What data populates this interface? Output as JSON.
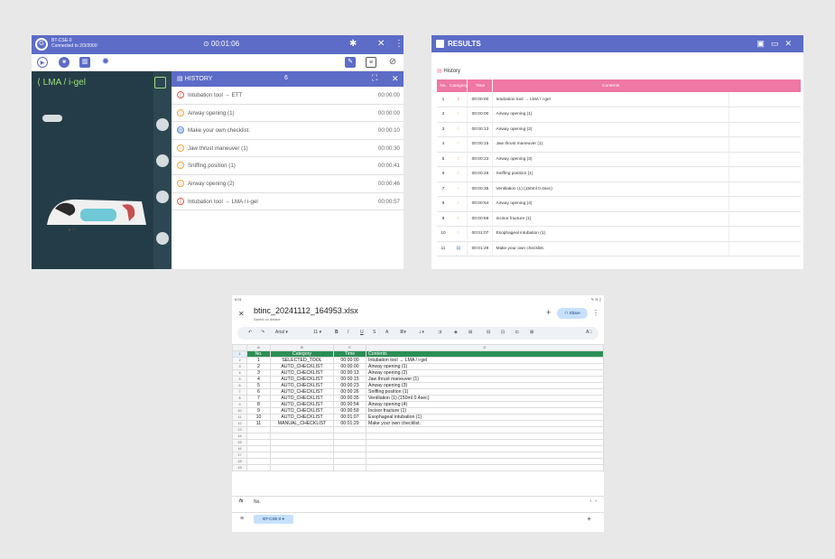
{
  "app": {
    "device_name": "BT-CSE-0",
    "device_status": "Connected to 2/3/2000",
    "timer": "⊙ 00:01:06",
    "topbar_icons": [
      "bluetooth-icon",
      "close-icon",
      "more-icon"
    ],
    "toolbar_icons": [
      "play-icon",
      "stop-icon",
      "chart-icon",
      "gear-icon",
      "report-icon",
      "document-icon",
      "mute-icon"
    ],
    "left_title": "⟨ LMA / i-gel",
    "history": {
      "title": "HISTORY",
      "count": "6",
      "items": [
        {
          "label": "Intubation tool → ETT",
          "time": "00:00:00",
          "icon": "tool-icon",
          "color": "#e05a4f"
        },
        {
          "label": "Airway opening (1)",
          "time": "00:00:00",
          "icon": "checklist-icon",
          "color": "#f0a23a"
        },
        {
          "label": "Make your own checklist.",
          "time": "00:00:10",
          "icon": "manual-icon",
          "color": "#5d8fd9"
        },
        {
          "label": "Jaw thrust maneuver (1)",
          "time": "00:00:30",
          "icon": "checklist-icon",
          "color": "#f0a23a"
        },
        {
          "label": "Sniffing position (1)",
          "time": "00:00:41",
          "icon": "checklist-icon",
          "color": "#f0a23a"
        },
        {
          "label": "Airway opening (2)",
          "time": "00:00:46",
          "icon": "checklist-icon",
          "color": "#f0a23a"
        },
        {
          "label": "Intubation tool → LMA / i-gel",
          "time": "00:00:57",
          "icon": "tool-icon",
          "color": "#e05a4f"
        }
      ]
    }
  },
  "results": {
    "title": "RESULTS",
    "icons": [
      "save-icon",
      "folder-icon",
      "close-icon"
    ],
    "history_label": "History",
    "columns": [
      "No.",
      "Category",
      "Time",
      "Contents"
    ],
    "rows": [
      {
        "no": "1",
        "time": "00:00:00",
        "content": "Intubation tool → LMA / i-gel",
        "icon_color": "#e05a4f"
      },
      {
        "no": "2",
        "time": "00:00:00",
        "content": "Airway opening (1)",
        "icon_color": "#f0a23a"
      },
      {
        "no": "3",
        "time": "00:00:13",
        "content": "Airway opening (2)",
        "icon_color": "#f0a23a"
      },
      {
        "no": "4",
        "time": "00:00:15",
        "content": "Jaw thrust maneuver (1)",
        "icon_color": "#f0a23a"
      },
      {
        "no": "5",
        "time": "00:00:23",
        "content": "Airway opening (3)",
        "icon_color": "#f0a23a"
      },
      {
        "no": "6",
        "time": "00:00:26",
        "content": "Sniffing position (1)",
        "icon_color": "#f0a23a"
      },
      {
        "no": "7",
        "time": "00:00:35",
        "content": "Ventilation (1) (150ml 0.4sec)",
        "icon_color": "#f0a23a"
      },
      {
        "no": "8",
        "time": "00:00:54",
        "content": "Airway opening (4)",
        "icon_color": "#f0a23a"
      },
      {
        "no": "9",
        "time": "00:00:59",
        "content": "Incisor fracture (1)",
        "icon_color": "#f0a23a"
      },
      {
        "no": "10",
        "time": "00:01:07",
        "content": "Esophageal intubation (1)",
        "icon_color": "#f0a23a"
      },
      {
        "no": "11",
        "time": "00:01:29",
        "content": "Make your own checklist.",
        "icon_color": "#5d8fd9"
      }
    ]
  },
  "sheet": {
    "status_time": "5:01",
    "status_right": "✎ ℅ ▯",
    "file_name": "btinc_20241112_164953.xlsx",
    "saved": "Saved on device",
    "share": "Share",
    "font": "Arial",
    "font_size": "11",
    "col_letters": [
      "",
      "A",
      "B",
      "C",
      "D"
    ],
    "header_row": [
      "No.",
      "Category",
      "Time",
      "Contents"
    ],
    "rows": [
      [
        "1",
        "SELECTED_TOOL",
        "00:00:00",
        "Intubation tool → LMA / i-gel"
      ],
      [
        "2",
        "AUTO_CHECKLIST",
        "00:00:00",
        "Airway opening (1)"
      ],
      [
        "3",
        "AUTO_CHECKLIST",
        "00:00:13",
        "Airway opening (2)"
      ],
      [
        "4",
        "AUTO_CHECKLIST",
        "00:00:15",
        "Jaw thrust maneuver (1)"
      ],
      [
        "5",
        "AUTO_CHECKLIST",
        "00:00:23",
        "Airway opening (3)"
      ],
      [
        "6",
        "AUTO_CHECKLIST",
        "00:00:26",
        "Sniffing position (1)"
      ],
      [
        "7",
        "AUTO_CHECKLIST",
        "00:00:35",
        "Ventilation (1) (150ml 0.4sec)"
      ],
      [
        "8",
        "AUTO_CHECKLIST",
        "00:00:54",
        "Airway opening (4)"
      ],
      [
        "9",
        "AUTO_CHECKLIST",
        "00:00:59",
        "Incisor fracture (1)"
      ],
      [
        "10",
        "AUTO_CHECKLIST",
        "00:01:07",
        "Esophageal intubation (1)"
      ],
      [
        "11",
        "MANUAL_CHECKLIST",
        "00:01:29",
        "Make your own checklist."
      ]
    ],
    "empty_row_numbers": [
      "13",
      "14",
      "15",
      "16",
      "17",
      "18",
      "19"
    ],
    "formula_value": "No.",
    "sheet_tab": "BT-CSE-0"
  }
}
